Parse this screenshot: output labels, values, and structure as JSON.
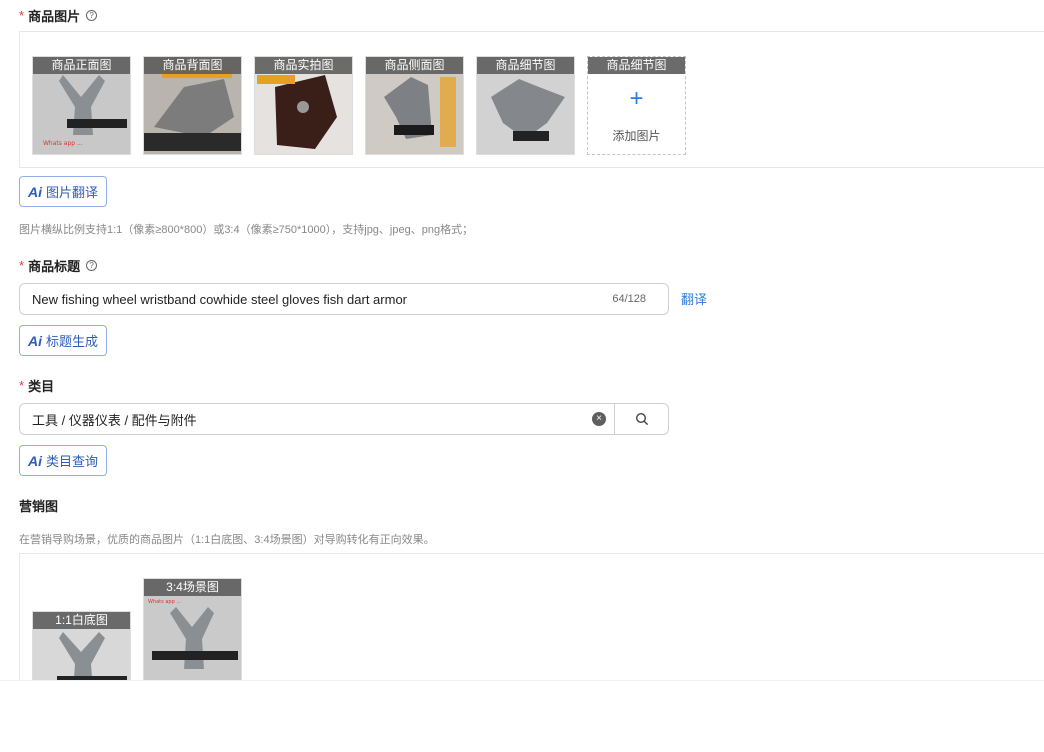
{
  "product_images": {
    "label": "商品图片",
    "thumbs": [
      {
        "caption": "商品正面图"
      },
      {
        "caption": "商品背面图"
      },
      {
        "caption": "商品实拍图"
      },
      {
        "caption": "商品侧面图"
      },
      {
        "caption": "商品细节图"
      }
    ],
    "add_slot": {
      "caption": "商品细节图",
      "label": "添加图片"
    },
    "ai_button": "图片翻译",
    "hint": "图片横纵比例支持1:1（像素≥800*800）或3:4（像素≥750*1000），支持jpg、jpeg、png格式；"
  },
  "product_title": {
    "label": "商品标题",
    "value": "New fishing wheel wristband cowhide steel gloves fish dart armor",
    "counter": "64/128",
    "translate_link": "翻译",
    "ai_button": "标题生成"
  },
  "category": {
    "label": "类目",
    "value": "工具 / 仪器仪表 / 配件与附件",
    "ai_button": "类目查询"
  },
  "marketing": {
    "label": "营销图",
    "hint": "在营销导购场景，优质的商品图片（1:1白底图、3:4场景图）对导购转化有正向效果。",
    "thumbs": [
      {
        "caption": "1:1白底图"
      },
      {
        "caption": "3:4场景图"
      }
    ]
  },
  "colors": {
    "accent": "#2c7be5",
    "required": "#e4393c"
  },
  "icons": {
    "ai": "ai-icon",
    "help": "question-circle-icon",
    "clear": "clear-icon",
    "search": "search-icon",
    "plus": "plus-icon"
  }
}
